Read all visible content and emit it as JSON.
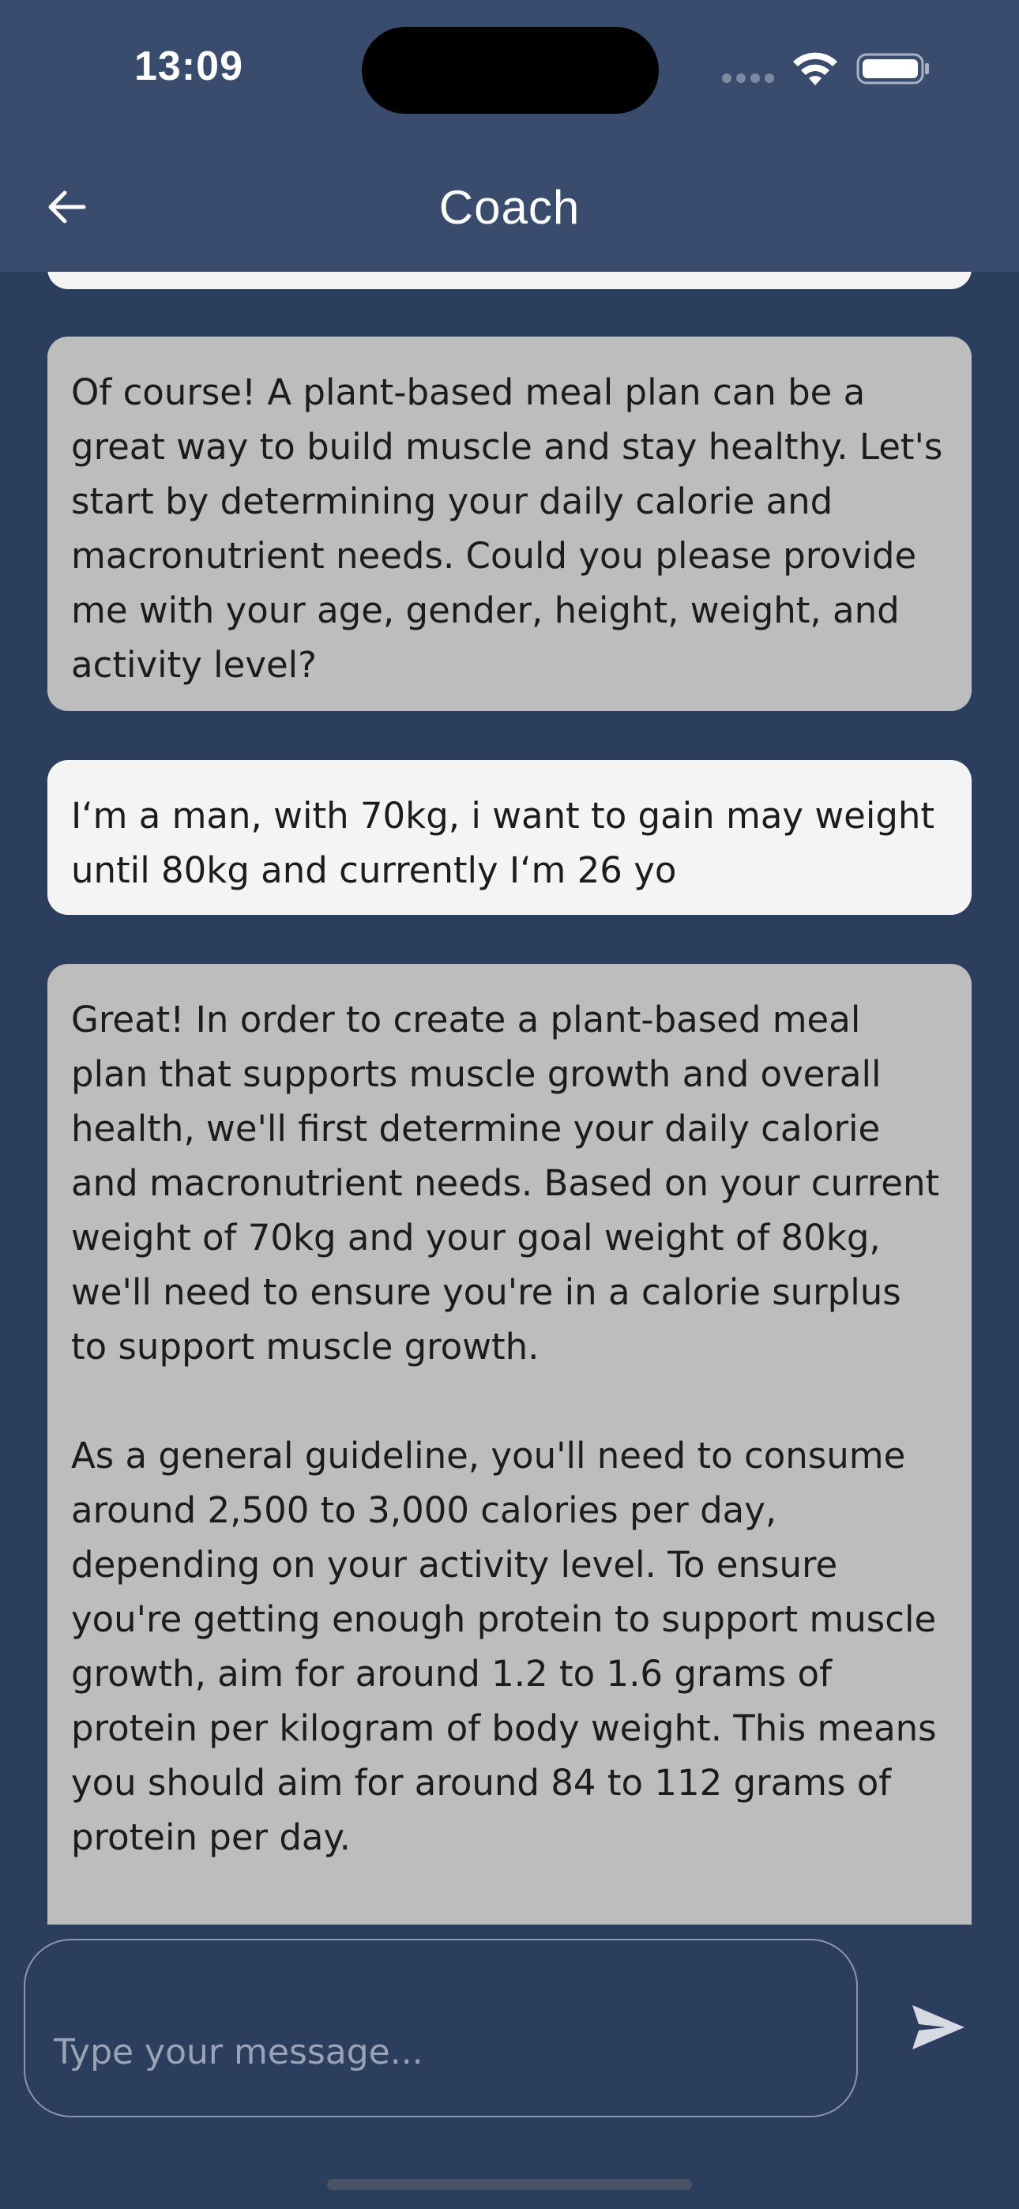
{
  "status_bar": {
    "time": "13:09",
    "icons": [
      "cellular-dots-icon",
      "wifi-icon",
      "battery-icon"
    ]
  },
  "header": {
    "title": "Coach",
    "back_icon": "arrow-left-icon"
  },
  "messages": [
    {
      "role": "user",
      "text": ""
    },
    {
      "role": "coach",
      "text": "Of course! A plant-based meal plan can be a great way to build muscle and stay healthy. Let's start by determining your daily calorie and macronutrient needs. Could you please provide me with your age, gender, height, weight, and activity level?"
    },
    {
      "role": "user",
      "text": "I‘m a man, with 70kg, i want to gain may weight until 80kg and currently I‘m 26 yo"
    },
    {
      "role": "coach",
      "text": "Great! In order to create a plant-based meal plan that supports muscle growth and overall health, we'll first determine your daily calorie and macronutrient needs. Based on your current weight of 70kg and your goal weight of 80kg, we'll need to ensure you're in a calorie surplus to support muscle growth.\n\nAs a general guideline, you'll need to consume around 2,500 to 3,000 calories per day, depending on your activity level. To ensure you're getting enough protein to support muscle growth, aim for around 1.2 to 1.6 grams of protein per kilogram of body weight. This means you should aim for around 84 to 112 grams of protein per day."
    }
  ],
  "composer": {
    "placeholder": "Type your message...",
    "send_icon": "send-icon"
  },
  "colors": {
    "background": "#2c3e5d",
    "header": "#3a4c6d",
    "coach_bubble": "#bdbdbd",
    "user_bubble": "#f4f4f4"
  }
}
